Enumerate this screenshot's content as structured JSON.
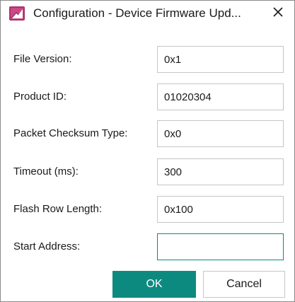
{
  "window": {
    "title": "Configuration - Device Firmware Upd...",
    "icon": "firmware-app-icon",
    "close_glyph": "✕"
  },
  "form": {
    "fields": [
      {
        "label": "File Version:",
        "value": "0x1"
      },
      {
        "label": "Product ID:",
        "value": "01020304"
      },
      {
        "label": "Packet Checksum Type:",
        "value": "0x0"
      },
      {
        "label": "Timeout (ms):",
        "value": "300"
      },
      {
        "label": "Flash Row Length:",
        "value": "0x100"
      },
      {
        "label": "Start Address:",
        "value": ""
      }
    ]
  },
  "buttons": {
    "ok_label": "OK",
    "cancel_label": "Cancel"
  },
  "colors": {
    "accent": "#0c8a80",
    "icon_primary": "#b0306a"
  }
}
